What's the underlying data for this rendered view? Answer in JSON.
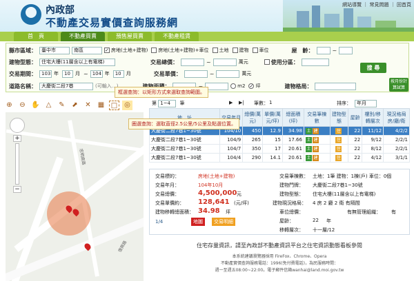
{
  "header": {
    "agency": "內政部",
    "title": "不動產交易實價查詢服務網",
    "top_links": "網站導覽 ｜ 常見問題 ｜ 回首頁"
  },
  "nav": [
    "首　頁",
    "不動產買賣",
    "預售屋買賣",
    "不動產租賃"
  ],
  "form": {
    "county_label": "縣市區域：",
    "county": "臺中市",
    "district": "南區",
    "types": [
      "房地(土地+建物)",
      "房地(土地+建物)+車位",
      "土地",
      "建物",
      "車位"
    ],
    "age_label": "屋　齡：",
    "building_label": "建物型態：",
    "building_type": "住宅大樓(11層含以上有電梯)",
    "total_label": "交易總價：",
    "total_unit": "萬元",
    "use_label": "使用分區：",
    "period_label": "交易期間：",
    "year_from": "103",
    "month_from": "10",
    "year_to": "104",
    "month_to": "10",
    "year_unit": "年",
    "month_unit": "月",
    "unit_price_label": "交易單價：",
    "unit_price_unit": "萬元",
    "search_button": "搜 尋",
    "road_label": "道路名稱：",
    "road": "大慶街二段7巷",
    "road_hint": "(可輸入…)",
    "area_label": "建物面積：",
    "m2": "m2",
    "ping": "坪",
    "layout_label": "建物格局：",
    "calc_button": "按月份計算試算"
  },
  "tools": {
    "tip1": "框選查詢：以矩形方式來選取查詢範圍。",
    "tip2": "圈選查詢：選取直徑2.5公里/5公里及點選位置。"
  },
  "pager": {
    "page_label": "第",
    "page": "1~4",
    "page_unit": "筆",
    "next": "▶",
    "end": "▶|",
    "total_label": "筆數：",
    "total": "1",
    "sort_label": "排序：",
    "sort": "年月"
  },
  "table": {
    "headers": [
      "地　址",
      "交易年月",
      "總價(萬元)",
      "單價(萬元/坪)",
      "總面積(坪)",
      "交易筆棟數",
      "建物型態",
      "屋齡",
      "樓別/移轉層次",
      "現況格局房/廳/衛"
    ],
    "rows": [
      {
        "address": "大慶街二段7巷1~30號",
        "date": "104/10",
        "total": "450",
        "unit": "12.9",
        "area": "34.98",
        "tags": [
          "土",
          "建"
        ],
        "type": "住",
        "age": "22",
        "floor": "11/12",
        "layout": "4/2/2"
      },
      {
        "address": "大慶街二段7巷1~30號",
        "date": "104/9",
        "total": "265",
        "unit": "15",
        "area": "17.66",
        "tags": [
          "土",
          "建"
        ],
        "type": "住",
        "age": "22",
        "floor": "9/12",
        "layout": "2/2/1"
      },
      {
        "address": "大慶街二段7巷1~30號",
        "date": "104/7",
        "total": "350",
        "unit": "17",
        "area": "20.61",
        "tags": [
          "土",
          "建"
        ],
        "type": "住",
        "age": "22",
        "floor": "8/12",
        "layout": "2/2/1"
      },
      {
        "address": "大慶街二段7巷1~30號",
        "date": "104/4",
        "total": "290",
        "unit": "14.1",
        "area": "20.61",
        "tags": [
          "土",
          "建"
        ],
        "type": "住",
        "age": "22",
        "floor": "4/12",
        "layout": "3/1/1"
      }
    ]
  },
  "detail": {
    "target_label": "交易標的：",
    "target": "房地(土地+建物)",
    "ym_label": "交易年月：",
    "ym": "104年10月",
    "total_label": "交易總價：",
    "total": "4,500,000",
    "total_unit": "元",
    "unit_label": "交易單價約：",
    "unit": "128,641",
    "unit_unit": "(元/坪)",
    "area_label": "建物移轉總面積：",
    "area": "34.98",
    "area_unit": "坪",
    "page": "1/4",
    "map_link": "地圖",
    "notes_link": "交易明細",
    "counts_label": "交易筆棟數：",
    "counts": "土地：1筆  建物：1棟(戶)  車位：0個",
    "land_label": "建物門牌：",
    "land": "大慶街二段7巷1~30號",
    "btype_label": "建物型態：",
    "btype": "住宅大樓(11層含以上有電梯)",
    "layout_label": "建物現況格局：",
    "layout": "4 房 2 廳 2 衛  有隔間",
    "parking_label": "車位總價：",
    "mgmt_label": "有無管理組織：",
    "mgmt": "有",
    "age_label": "屋齡：",
    "age": "22",
    "age_unit": "年",
    "floor_label": "移轉層次：",
    "floor": "十一層/12"
  },
  "footer": {
    "line1": "住宅存量資訊，請至內政部不動產資訊平台之住宅資訊動態看板參閱",
    "line2": "本系統建議瀏覽器採用 FireFox、Chrome、Opera",
    "line3": "不動產實價查詢服務電話：1996(免付費電話)，為民服務時間：",
    "line4": "週一至週五08:00~22:00。電子郵件信箱wanhai@land.moi.gov.tw"
  },
  "map": {
    "labels": [
      "忠明南路",
      "復興路"
    ]
  },
  "colors": {
    "nav": "#a9cf4d",
    "selected_row": "#3b7fc4",
    "land_tag": "#3a9a3a",
    "build_tag": "#d88a1a",
    "price_red": "#d03020"
  }
}
